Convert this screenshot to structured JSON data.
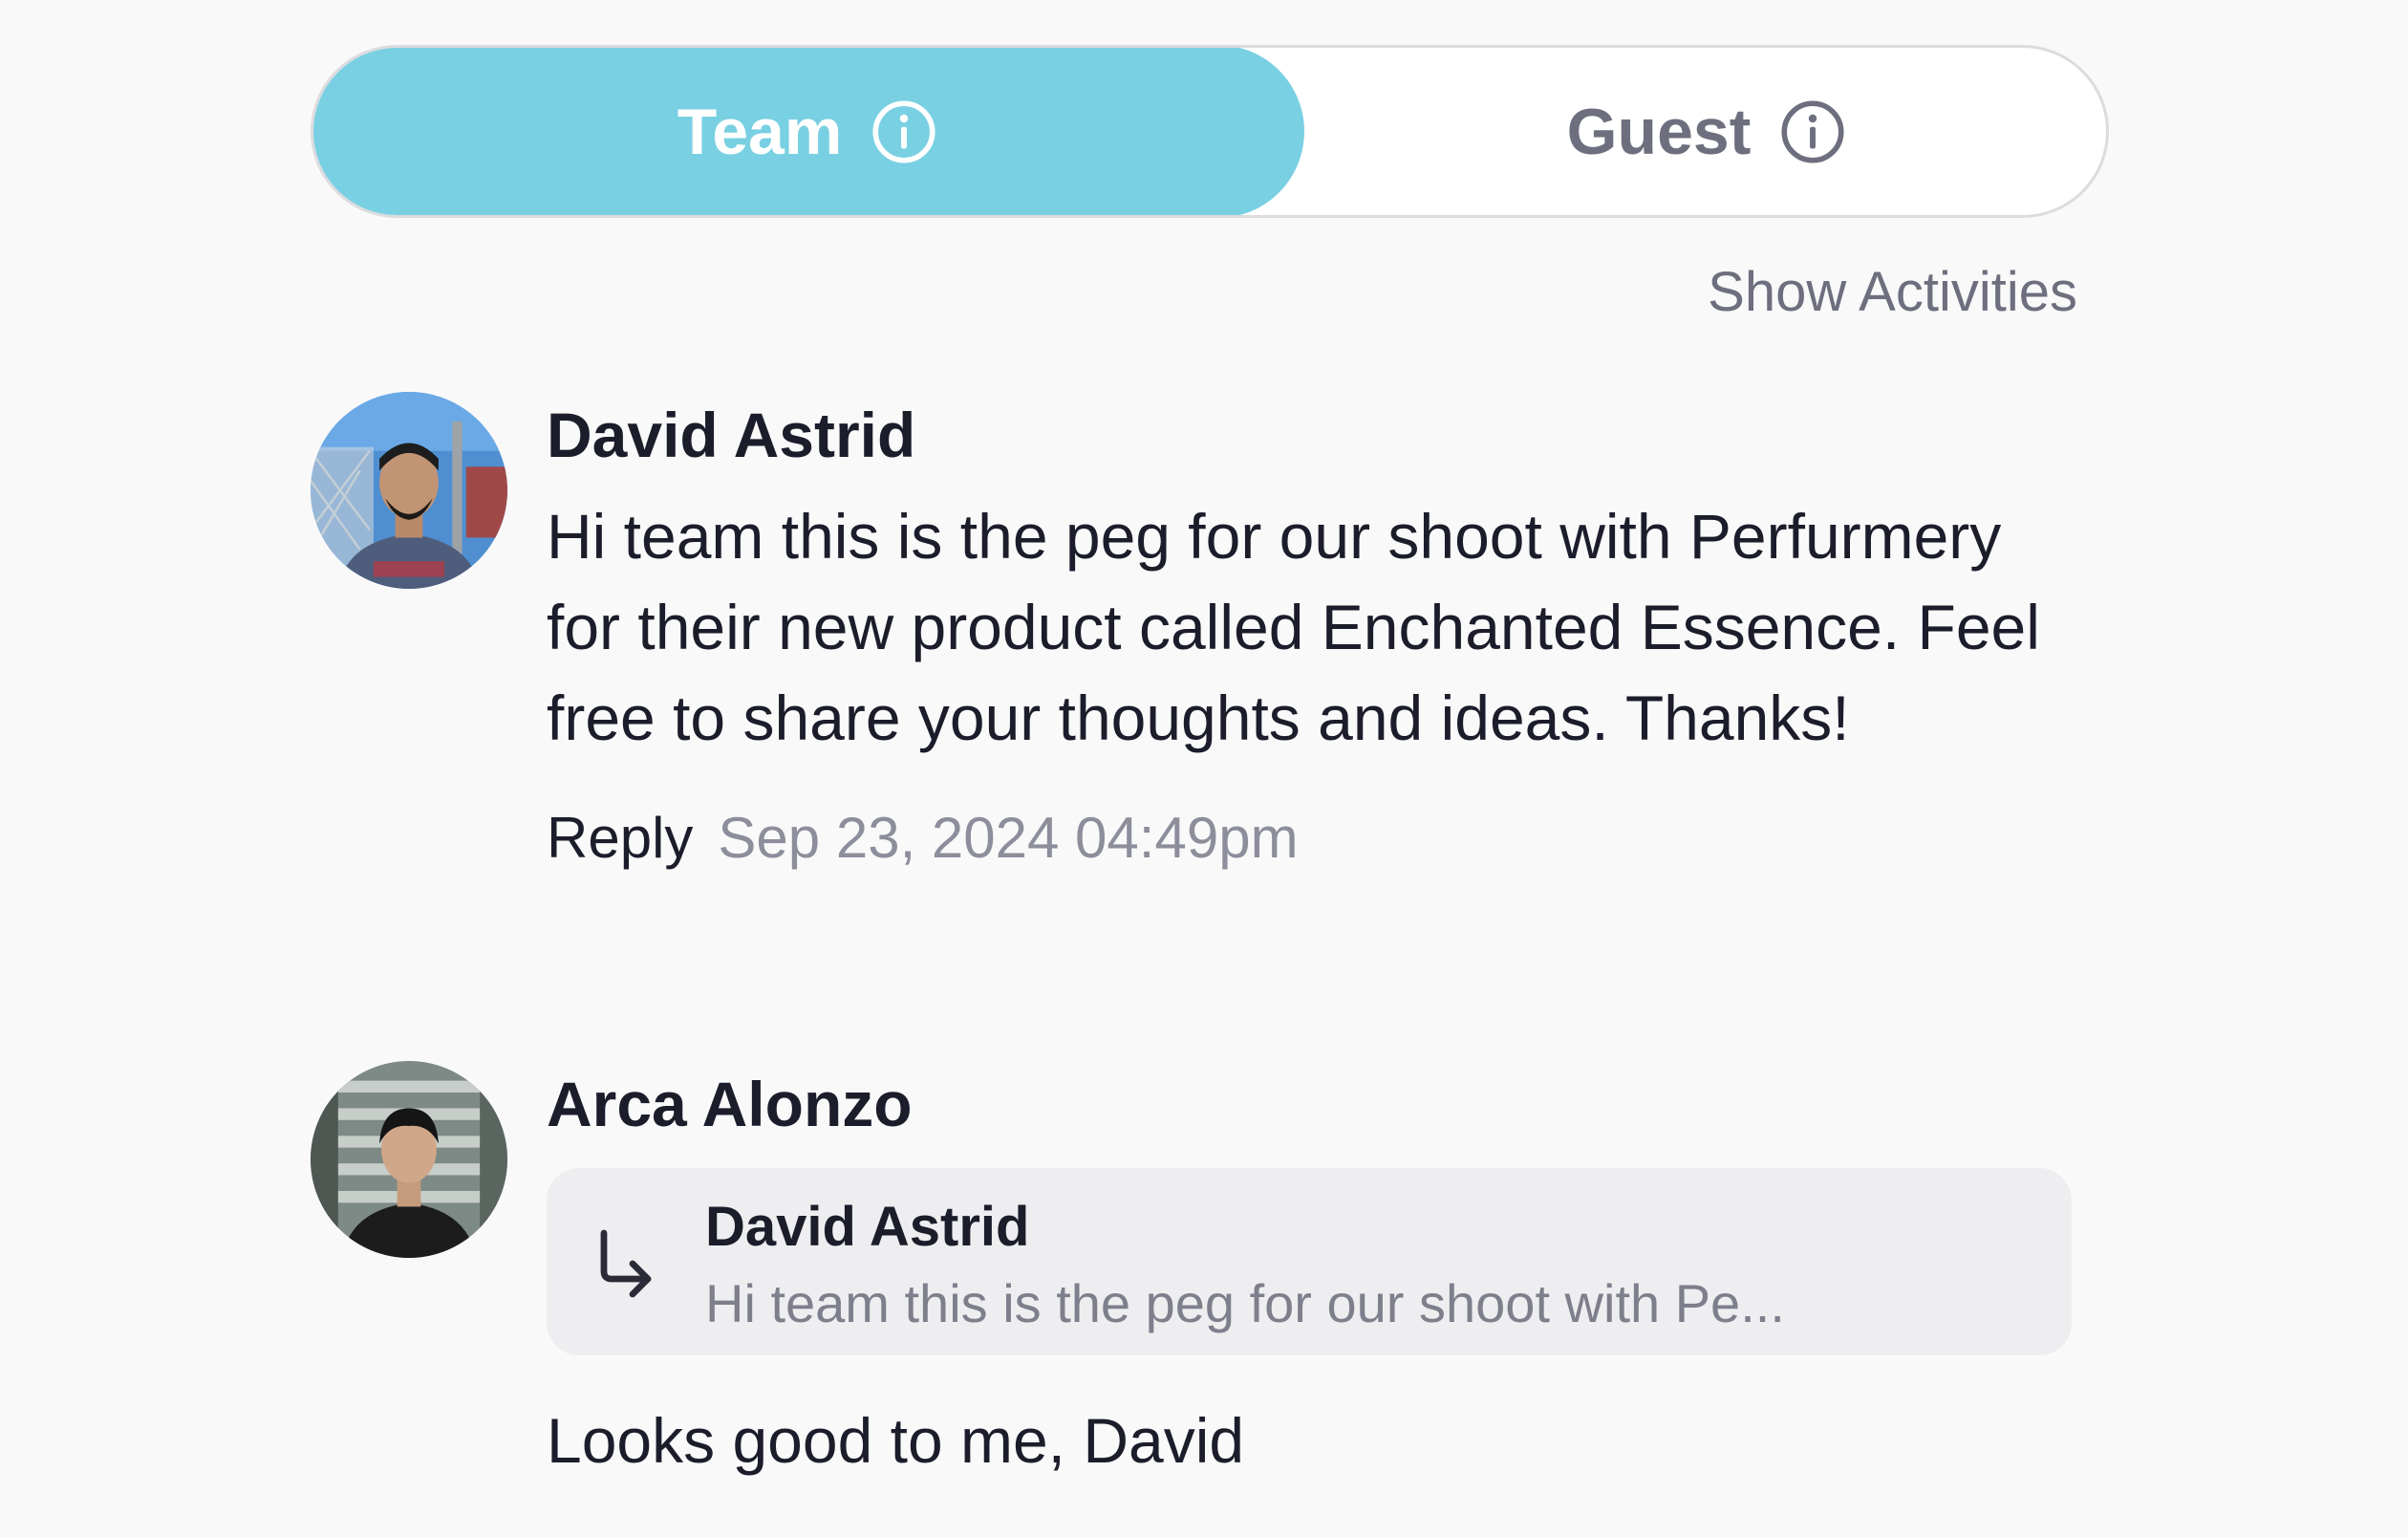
{
  "tabs": {
    "team": {
      "label": "Team",
      "active": true
    },
    "guest": {
      "label": "Guest",
      "active": false
    }
  },
  "show_activities_label": "Show Activities",
  "comments": [
    {
      "author": "David Astrid",
      "avatar_icon": "avatar-photo",
      "text": "Hi team this is the peg for our shoot with Perfurmery for their new product called Enchanted Essence. Feel free to share your thoughts and ideas. Thanks!",
      "reply_label": "Reply",
      "timestamp": "Sep 23, 2024 04:49pm"
    },
    {
      "author": "Arca Alonzo",
      "avatar_icon": "avatar-photo",
      "quote": {
        "icon": "reply-arrow-icon",
        "author": "David Astrid",
        "excerpt": "Hi team this is the peg for our shoot with Pe..."
      },
      "text": "Looks good to me, David"
    }
  ],
  "colors": {
    "accent": "#79d0e2",
    "background": "#f9f9fa",
    "text_primary": "#1c1d2b",
    "text_muted": "#8d8e9b",
    "quote_bg": "#eeeef0"
  }
}
